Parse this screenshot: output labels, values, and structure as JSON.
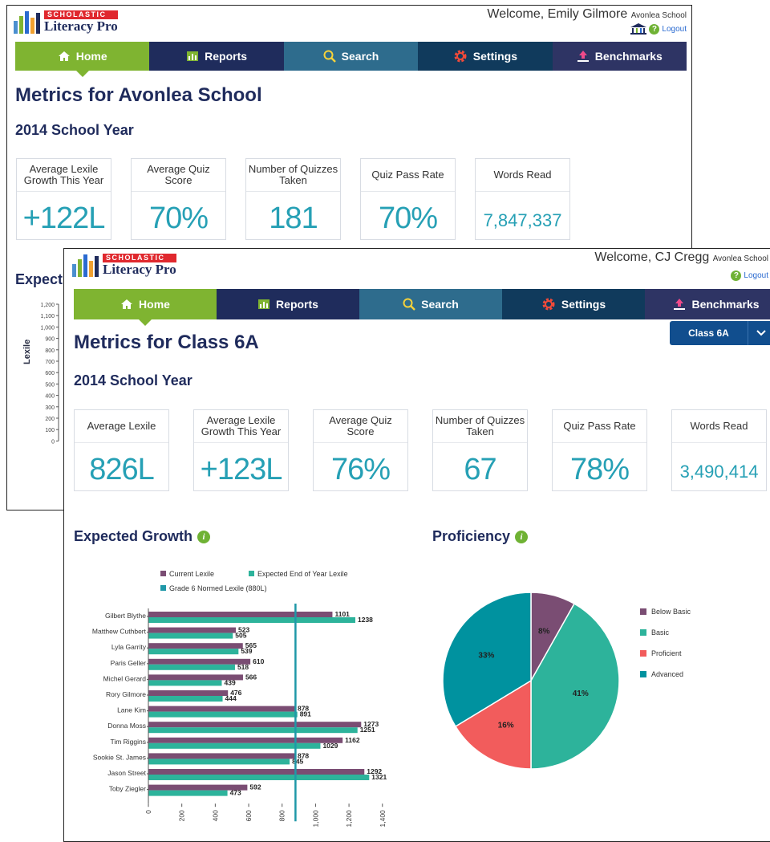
{
  "back": {
    "logo": {
      "scholastic": "SCHOLASTIC",
      "name": "Literacy Pro"
    },
    "welcome": {
      "text": "Welcome, Emily Gilmore",
      "school": "Avonlea School"
    },
    "logout": "Logout",
    "nav": {
      "home": "Home",
      "reports": "Reports",
      "search": "Search",
      "settings": "Settings",
      "benchmarks": "Benchmarks"
    },
    "title": "Metrics for Avonlea School",
    "year": "2014 School Year",
    "metrics": [
      {
        "label": "Average Lexile Growth This Year",
        "value": "+122L"
      },
      {
        "label": "Average Quiz Score",
        "value": "70%"
      },
      {
        "label": "Number of Quizzes Taken",
        "value": "181"
      },
      {
        "label": "Quiz Pass Rate",
        "value": "70%"
      },
      {
        "label": "Words Read",
        "value": "7,847,337"
      }
    ],
    "expected_title_partial": "Expect",
    "y_axis_label": "Lexile",
    "y_ticks": [
      "1,200",
      "1,100",
      "1,000",
      "900",
      "800",
      "700",
      "600",
      "500",
      "400",
      "300",
      "200",
      "100",
      "0"
    ]
  },
  "front": {
    "logo": {
      "scholastic": "SCHOLASTIC",
      "name": "Literacy Pro"
    },
    "welcome": {
      "text": "Welcome, CJ Cregg",
      "school": "Avonlea School"
    },
    "logout": "Logout",
    "nav": {
      "home": "Home",
      "reports": "Reports",
      "search": "Search",
      "settings": "Settings",
      "benchmarks": "Benchmarks"
    },
    "title": "Metrics for Class 6A",
    "class_select": {
      "value": "Class 6A"
    },
    "year": "2014 School Year",
    "metrics": [
      {
        "label": "Average Lexile",
        "value": "826L"
      },
      {
        "label": "Average Lexile Growth This Year",
        "value": "+123L"
      },
      {
        "label": "Average Quiz Score",
        "value": "76%"
      },
      {
        "label": "Number of Quizzes Taken",
        "value": "67"
      },
      {
        "label": "Quiz Pass Rate",
        "value": "78%"
      },
      {
        "label": "Words Read",
        "value": "3,490,414"
      }
    ],
    "expected_growth_title": "Expected Growth",
    "proficiency_title": "Proficiency"
  },
  "colors": {
    "current": "#7a4d73",
    "expected": "#2db39b",
    "normed": "#1f98a8",
    "below_basic": "#7a4d73",
    "basic": "#2db39b",
    "proficient": "#f25c5c",
    "advanced": "#00929f"
  },
  "chart_data": [
    {
      "type": "bar",
      "orientation": "horizontal",
      "categories": [
        "Gilbert Blythe",
        "Matthew Cuthbert",
        "Lyla Garrity",
        "Paris Geller",
        "Michel Gerard",
        "Rory Gilmore",
        "Lane Kim",
        "Donna Moss",
        "Tim Riggins",
        "Sookie St. James",
        "Jason Street",
        "Toby Ziegler"
      ],
      "series": [
        {
          "name": "Current Lexile",
          "values": [
            1101,
            523,
            565,
            610,
            566,
            476,
            878,
            1273,
            1162,
            878,
            1292,
            592
          ]
        },
        {
          "name": "Expected End of Year Lexile",
          "values": [
            1238,
            505,
            539,
            518,
            439,
            444,
            891,
            1251,
            1029,
            845,
            1321,
            473
          ]
        }
      ],
      "reference_line": {
        "name": "Grade 6 Normed Lexile (880L)",
        "value": 880
      },
      "xlim": [
        0,
        1500
      ],
      "x_ticks": [
        "0",
        "200",
        "400",
        "600",
        "800",
        "1,000",
        "1,200",
        "1,400"
      ],
      "legend": "top"
    },
    {
      "type": "pie",
      "labels": [
        "Below Basic",
        "Basic",
        "Proficient",
        "Advanced"
      ],
      "values": [
        8,
        41,
        16,
        33
      ],
      "value_labels": [
        "8%",
        "41%",
        "16%",
        "33%"
      ],
      "legend": "right"
    }
  ]
}
